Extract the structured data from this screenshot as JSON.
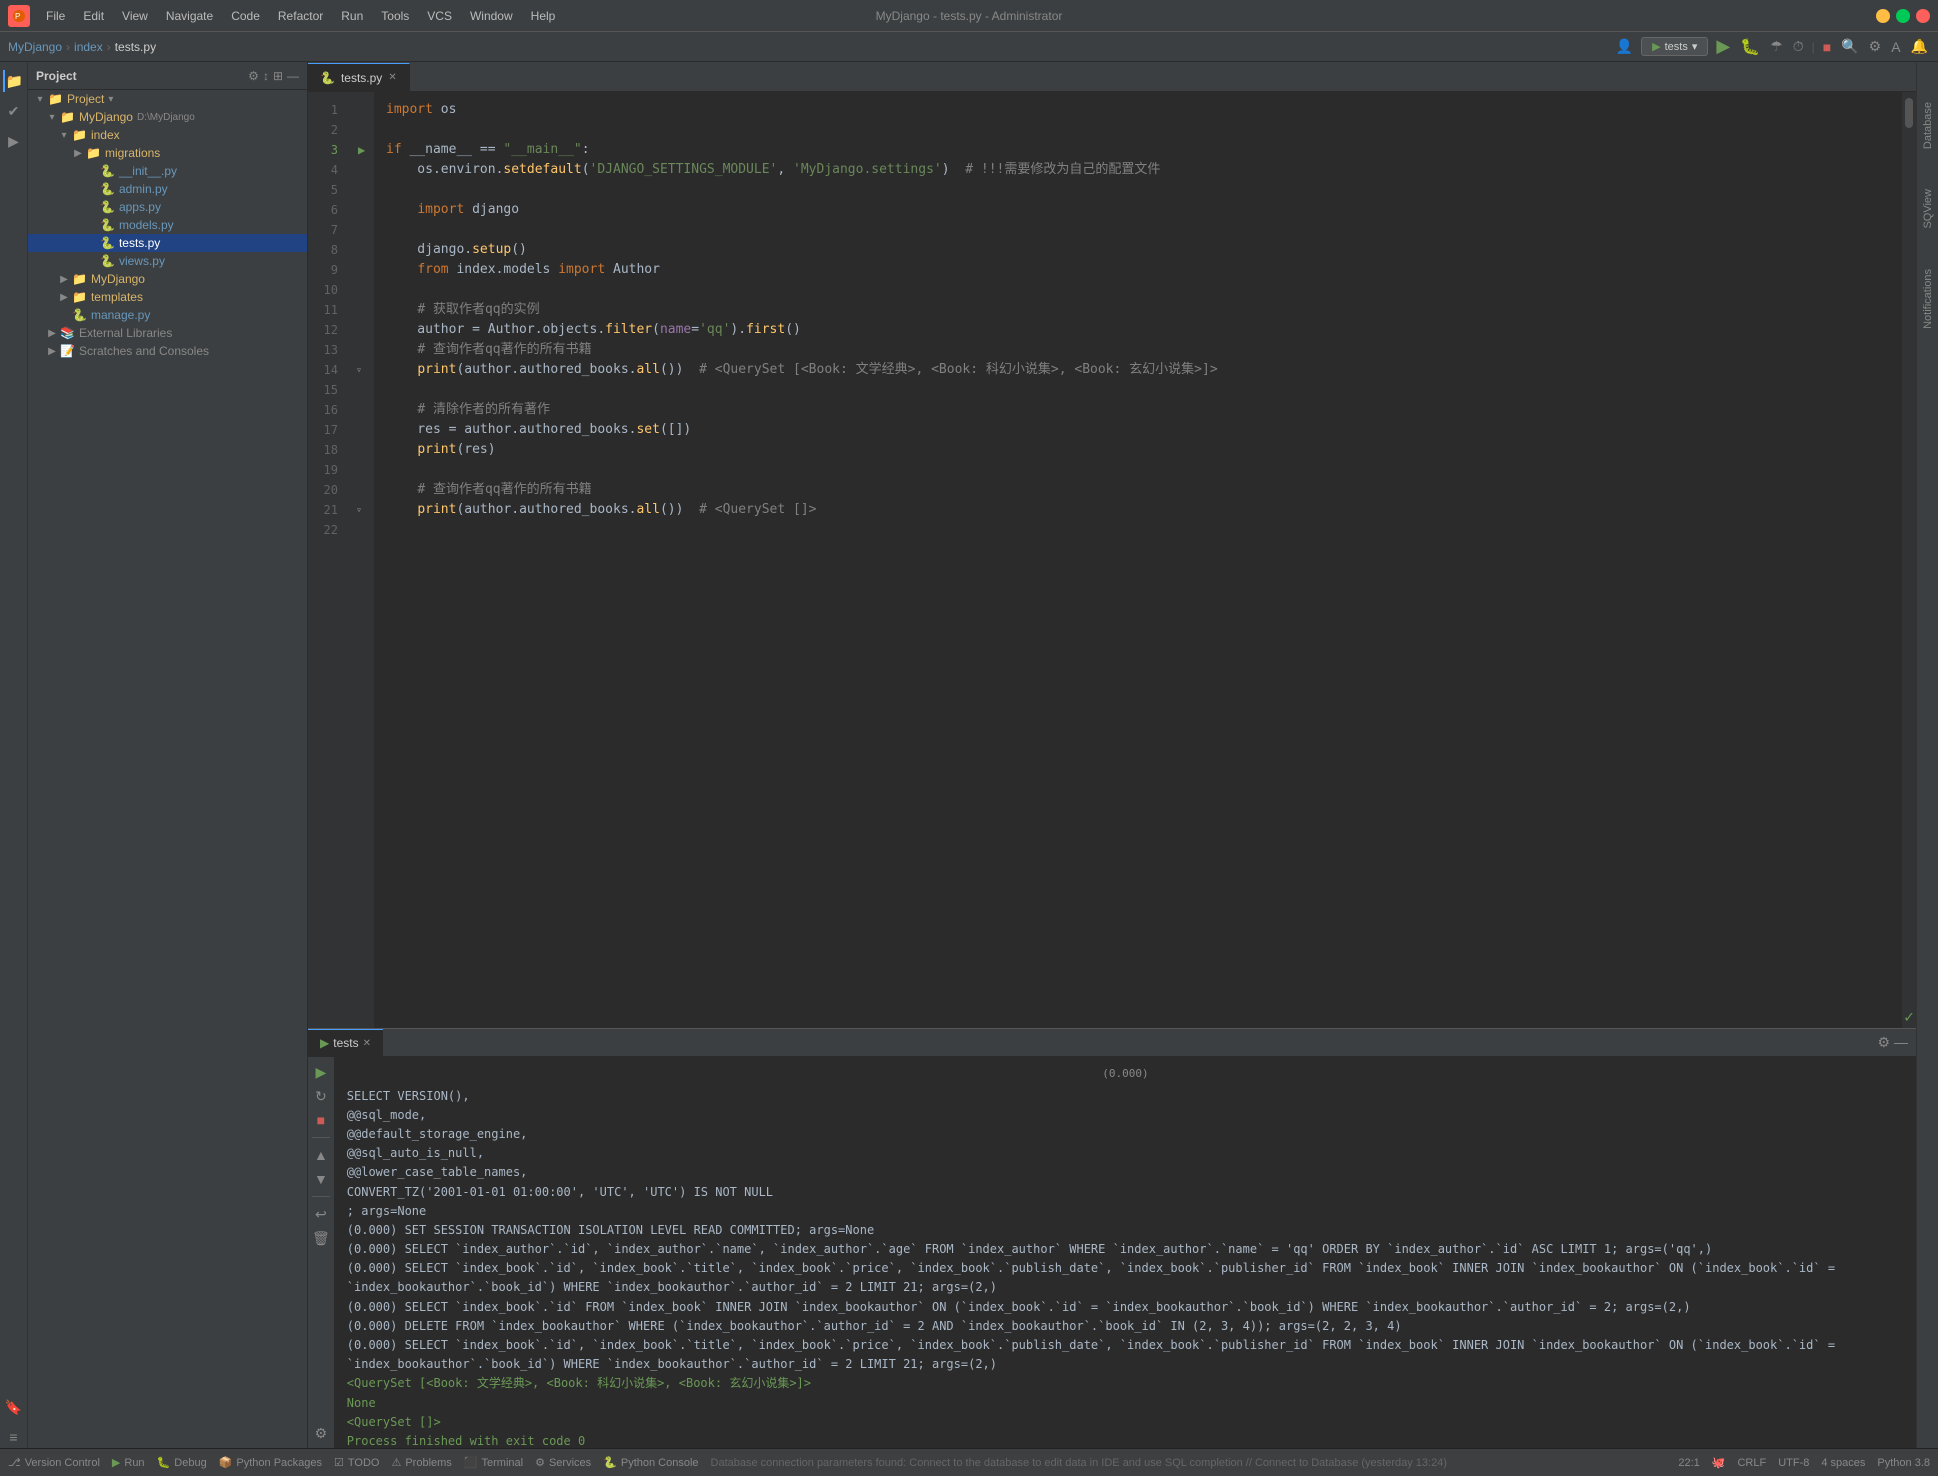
{
  "titlebar": {
    "title": "MyDjango - tests.py - Administrator",
    "menus": [
      "File",
      "Edit",
      "View",
      "Navigate",
      "Code",
      "Refactor",
      "Run",
      "Tools",
      "VCS",
      "Window",
      "Help"
    ]
  },
  "breadcrumb": {
    "items": [
      "MyDjango",
      "index",
      "tests.py"
    ]
  },
  "run_config": {
    "name": "tests",
    "dropdown_label": "tests"
  },
  "sidebar": {
    "header": "Project",
    "tree": [
      {
        "id": "project-root",
        "label": "Project",
        "indent": 0,
        "type": "root",
        "expanded": true
      },
      {
        "id": "mydjango",
        "label": "MyDjango",
        "indent": 1,
        "type": "folder",
        "path": "D:\\MyDjango",
        "expanded": true
      },
      {
        "id": "index",
        "label": "index",
        "indent": 2,
        "type": "folder",
        "expanded": true
      },
      {
        "id": "migrations",
        "label": "migrations",
        "indent": 3,
        "type": "folder",
        "expanded": false
      },
      {
        "id": "init",
        "label": "__init__.py",
        "indent": 4,
        "type": "py"
      },
      {
        "id": "admin",
        "label": "admin.py",
        "indent": 4,
        "type": "py"
      },
      {
        "id": "apps",
        "label": "apps.py",
        "indent": 4,
        "type": "py"
      },
      {
        "id": "models",
        "label": "models.py",
        "indent": 4,
        "type": "py"
      },
      {
        "id": "tests",
        "label": "tests.py",
        "indent": 4,
        "type": "py",
        "active": true
      },
      {
        "id": "views",
        "label": "views.py",
        "indent": 4,
        "type": "py"
      },
      {
        "id": "mydjango2",
        "label": "MyDjango",
        "indent": 2,
        "type": "folder",
        "expanded": false
      },
      {
        "id": "templates",
        "label": "templates",
        "indent": 2,
        "type": "folder",
        "expanded": false
      },
      {
        "id": "manage",
        "label": "manage.py",
        "indent": 2,
        "type": "py"
      },
      {
        "id": "external-libs",
        "label": "External Libraries",
        "indent": 1,
        "type": "external",
        "expanded": false
      },
      {
        "id": "scratches",
        "label": "Scratches and Consoles",
        "indent": 1,
        "type": "scratches"
      }
    ]
  },
  "editor": {
    "active_tab": "tests.py",
    "lines": [
      {
        "num": 1,
        "code": "import os"
      },
      {
        "num": 2,
        "code": ""
      },
      {
        "num": 3,
        "code": "if __name__ == \"__main__\":",
        "runnable": true
      },
      {
        "num": 4,
        "code": "    os.environ.setdefault('DJANGO_SETTINGS_MODULE', 'MyDjango.settings')  # !!!需要修改为自己的配置文件"
      },
      {
        "num": 5,
        "code": ""
      },
      {
        "num": 6,
        "code": "    import django"
      },
      {
        "num": 7,
        "code": ""
      },
      {
        "num": 8,
        "code": "    django.setup()"
      },
      {
        "num": 9,
        "code": "    from index.models import Author"
      },
      {
        "num": 10,
        "code": ""
      },
      {
        "num": 11,
        "code": "    # 获取作者qq的实例"
      },
      {
        "num": 12,
        "code": "    author = Author.objects.filter(name='qq').first()"
      },
      {
        "num": 13,
        "code": "    # 查询作者qq著作的所有书籍"
      },
      {
        "num": 14,
        "code": "    print(author.authored_books.all())  # <QuerySet [<Book: 文学经典>, <Book: 科幻小说集>, <Book: 玄幻小说集>]>"
      },
      {
        "num": 15,
        "code": ""
      },
      {
        "num": 16,
        "code": "    # 清除作者的所有著作"
      },
      {
        "num": 17,
        "code": "    res = author.authored_books.set([])"
      },
      {
        "num": 18,
        "code": "    print(res)"
      },
      {
        "num": 19,
        "code": ""
      },
      {
        "num": 20,
        "code": "    # 查询作者qq著作的所有书籍"
      },
      {
        "num": 21,
        "code": "    print(author.authored_books.all())  # <QuerySet []>"
      },
      {
        "num": 22,
        "code": ""
      }
    ]
  },
  "run_panel": {
    "tab_label": "tests",
    "output_lines": [
      {
        "text": "    SELECT VERSION(),",
        "type": "sql"
      },
      {
        "text": "            @@sql_mode,",
        "type": "sql"
      },
      {
        "text": "            @@default_storage_engine,",
        "type": "sql"
      },
      {
        "text": "            @@sql_auto_is_null,",
        "type": "sql"
      },
      {
        "text": "            @@lower_case_table_names,",
        "type": "sql"
      },
      {
        "text": "            CONVERT_TZ('2001-01-01 01:00:00', 'UTC', 'UTC') IS NOT NULL",
        "type": "sql"
      },
      {
        "text": "; args=None",
        "type": "sql"
      },
      {
        "text": "(0.000) SET SESSION TRANSACTION ISOLATION LEVEL READ COMMITTED; args=None",
        "type": "sql"
      },
      {
        "text": "(0.000) SELECT `index_author`.`id`, `index_author`.`name`, `index_author`.`age` FROM `index_author` WHERE `index_author`.`name` = 'qq' ORDER BY `index_author`.`id` ASC LIMIT 1; args=('qq',)",
        "type": "sql"
      },
      {
        "text": "(0.000) SELECT `index_book`.`id`, `index_book`.`title`, `index_book`.`price`, `index_book`.`publish_date`, `index_book`.`publisher_id` FROM `index_book` INNER JOIN `index_bookauthor` ON (`index_book`.`id` = `index_bookauthor`.`book_id`) WHERE `index_bookauthor`.`author_id` = 2 LIMIT 21; args=(2,)",
        "type": "sql"
      },
      {
        "text": "(0.000) SELECT `index_book`.`id` FROM `index_book` INNER JOIN `index_bookauthor` ON (`index_book`.`id` = `index_bookauthor`.`book_id`) WHERE `index_bookauthor`.`author_id` = 2; args=(2,)",
        "type": "sql"
      },
      {
        "text": "(0.000) DELETE FROM `index_bookauthor` WHERE (`index_bookauthor`.`author_id` = 2 AND `index_bookauthor`.`book_id` IN (2, 3, 4)); args=(2, 2, 3, 4)",
        "type": "sql"
      },
      {
        "text": "(0.000) SELECT `index_book`.`id`, `index_book`.`title`, `index_book`.`price`, `index_book`.`publish_date`, `index_book`.`publisher_id` FROM `index_book` INNER JOIN `index_bookauthor` ON (`index_book`.`id` = `index_bookauthor`.`book_id`) WHERE `index_bookauthor`.`author_id` = 2 LIMIT 21; args=(2,)",
        "type": "sql"
      },
      {
        "text": "<QuerySet [<Book: 文学经典>, <Book: 科幻小说集>, <Book: 玄幻小说集>]>",
        "type": "result"
      },
      {
        "text": "None",
        "type": "result"
      },
      {
        "text": "<QuerySet []>",
        "type": "result"
      },
      {
        "text": "",
        "type": "normal"
      },
      {
        "text": "Process finished with exit code 0",
        "type": "success"
      }
    ]
  },
  "status_bar": {
    "version_control": "Version Control",
    "run": "Run",
    "debug": "Debug",
    "python_packages": "Python Packages",
    "todo": "TODO",
    "problems": "Problems",
    "terminal": "Terminal",
    "services": "Services",
    "python_console": "Python Console",
    "line_col": "22:1",
    "encoding": "UTF-8",
    "line_sep": "CRLF",
    "indent": "4 spaces",
    "python_version": "Python 3.8",
    "status_message": "Database connection parameters found: Connect to the database to edit data in IDE and use SQL completion // Connect to Database (yesterday 13:24)"
  }
}
